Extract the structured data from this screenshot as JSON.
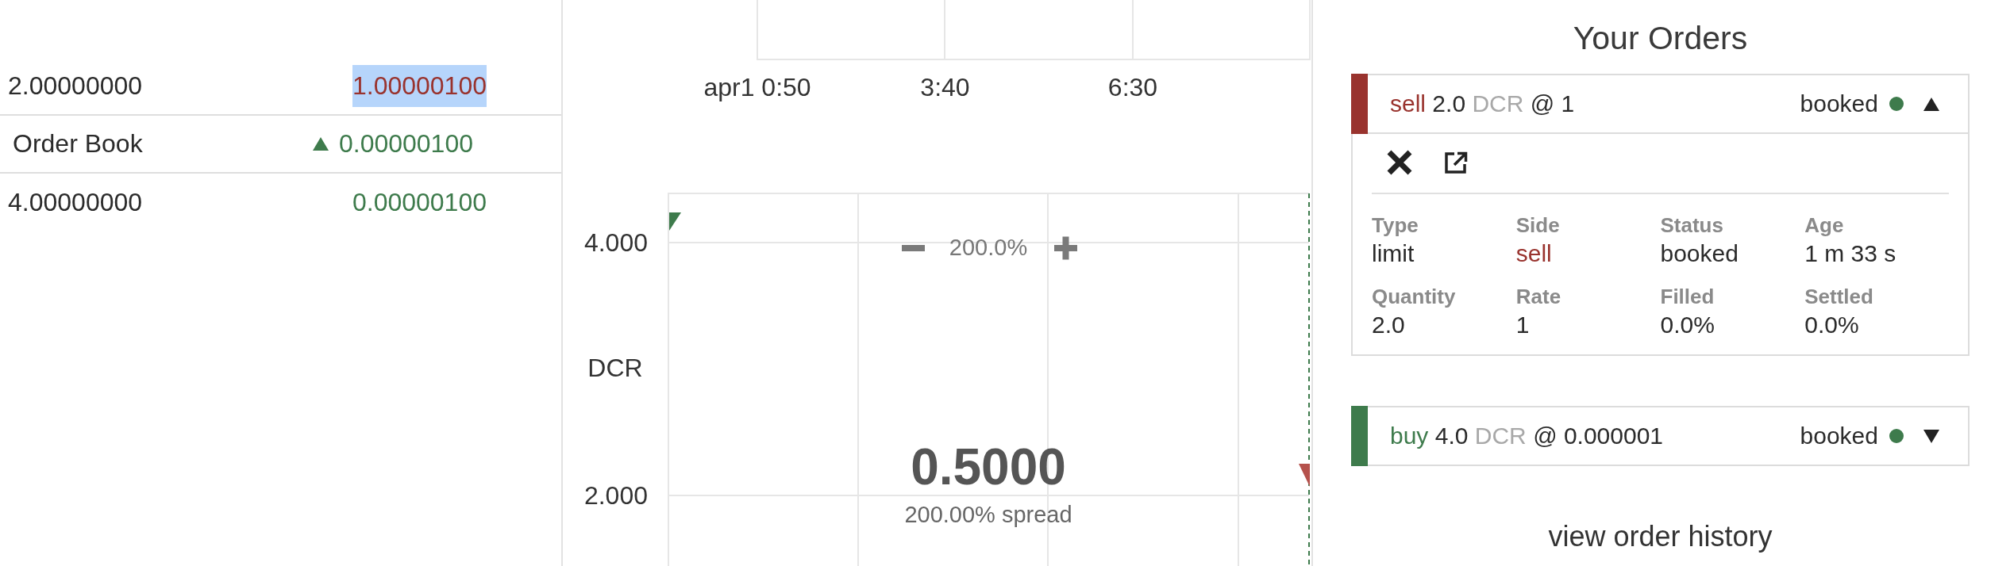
{
  "order_book": {
    "rows": [
      {
        "kind": "sell",
        "quantity": "2.00000000",
        "rate": "1.00000100",
        "text_selected": true
      },
      {
        "kind": "mid",
        "label": "Order Book",
        "change": "0.00000100",
        "rising": true
      },
      {
        "kind": "buy",
        "quantity": "4.00000000",
        "rate": "0.00000100",
        "text_selected": false
      }
    ]
  },
  "price_chart": {
    "x_ticks": [
      "apr1 0:50",
      "3:40",
      "6:30"
    ]
  },
  "depth_chart": {
    "y_ticks": [
      "4.000",
      "2.000"
    ],
    "unit": "DCR",
    "zoom_level": "200.0%",
    "mid_gap": "0.5000",
    "spread": "200.00% spread"
  },
  "your_orders": {
    "title": "Your Orders",
    "orders": [
      {
        "kind": "sell",
        "side": "sell",
        "quantity": "2.0",
        "asset": "DCR",
        "price": "@ 1",
        "status": "booked",
        "expanded": true,
        "details": [
          {
            "label": "Type",
            "value": "limit",
            "kind": "plain"
          },
          {
            "label": "Side",
            "value": "sell",
            "kind": "side"
          },
          {
            "label": "Status",
            "value": "booked",
            "kind": "plain"
          },
          {
            "label": "Age",
            "value": "1 m 33 s",
            "kind": "plain"
          },
          {
            "label": "Quantity",
            "value": "2.0",
            "kind": "plain"
          },
          {
            "label": "Rate",
            "value": "1",
            "kind": "plain"
          },
          {
            "label": "Filled",
            "value": "0.0%",
            "kind": "plain"
          },
          {
            "label": "Settled",
            "value": "0.0%",
            "kind": "plain"
          }
        ]
      },
      {
        "kind": "buy",
        "side": "buy",
        "quantity": "4.0",
        "asset": "DCR",
        "price": "@ 0.000001",
        "status": "booked",
        "expanded": false
      }
    ],
    "history_link": "view order history"
  }
}
